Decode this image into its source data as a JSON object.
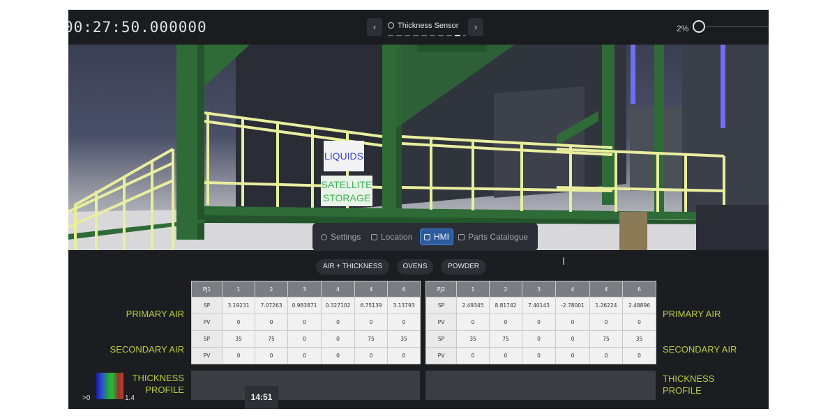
{
  "top_bar": {
    "clock": "00:27:50.000000",
    "pager_label": "Thickness Sensor",
    "prev_icon": "‹",
    "next_icon": "›",
    "zoom_label": "2%",
    "zoom_value": 0.02
  },
  "scene": {
    "sign_liquids": "LIQUIDS",
    "sign_satellite_line1": "SATELLITE",
    "sign_satellite_line2": "STORAGE"
  },
  "tabs": [
    {
      "label": "Settings",
      "icon": "gear-icon"
    },
    {
      "label": "Location",
      "icon": "document-icon"
    },
    {
      "label": "HMI",
      "icon": "hmi-icon",
      "active": true
    },
    {
      "label": "Parts Catalogue",
      "icon": "catalogue-icon"
    }
  ],
  "subtabs": [
    "AIR + THICKNESS",
    "OVENS",
    "POWDER"
  ],
  "labels": {
    "primary_air": "PRIMARY AIR",
    "secondary_air": "SECONDARY AIR",
    "thickness_profile_line1": "THICKNESS",
    "thickness_profile_line2": "PROFILE"
  },
  "legend": {
    "min": ">0",
    "max": "1.4"
  },
  "timecode": "14:51",
  "table_left": {
    "header": [
      "PJ1",
      "1",
      "2",
      "3",
      "4",
      "4",
      "6"
    ],
    "rows": [
      [
        "SP",
        "3.19231",
        "7.07263",
        "0.983871",
        "0.327102",
        "6.75139",
        "3.13793"
      ],
      [
        "PV",
        "0",
        "0",
        "0",
        "0",
        "0",
        "0"
      ],
      [
        "SP",
        "35",
        "75",
        "0",
        "0",
        "75",
        "35"
      ],
      [
        "PV",
        "0",
        "0",
        "0",
        "0",
        "0",
        "0"
      ]
    ]
  },
  "table_right": {
    "header": [
      "PJ2",
      "1",
      "2",
      "3",
      "4",
      "4",
      "6"
    ],
    "rows": [
      [
        "SP",
        "2.49345",
        "8.81742",
        "7.40143",
        "-2.78001",
        "1.26224",
        "2.48896"
      ],
      [
        "PV",
        "0",
        "0",
        "0",
        "0",
        "0",
        "0"
      ],
      [
        "SP",
        "35",
        "75",
        "0",
        "0",
        "75",
        "35"
      ],
      [
        "PV",
        "0",
        "0",
        "0",
        "0",
        "0",
        "0"
      ]
    ]
  }
}
